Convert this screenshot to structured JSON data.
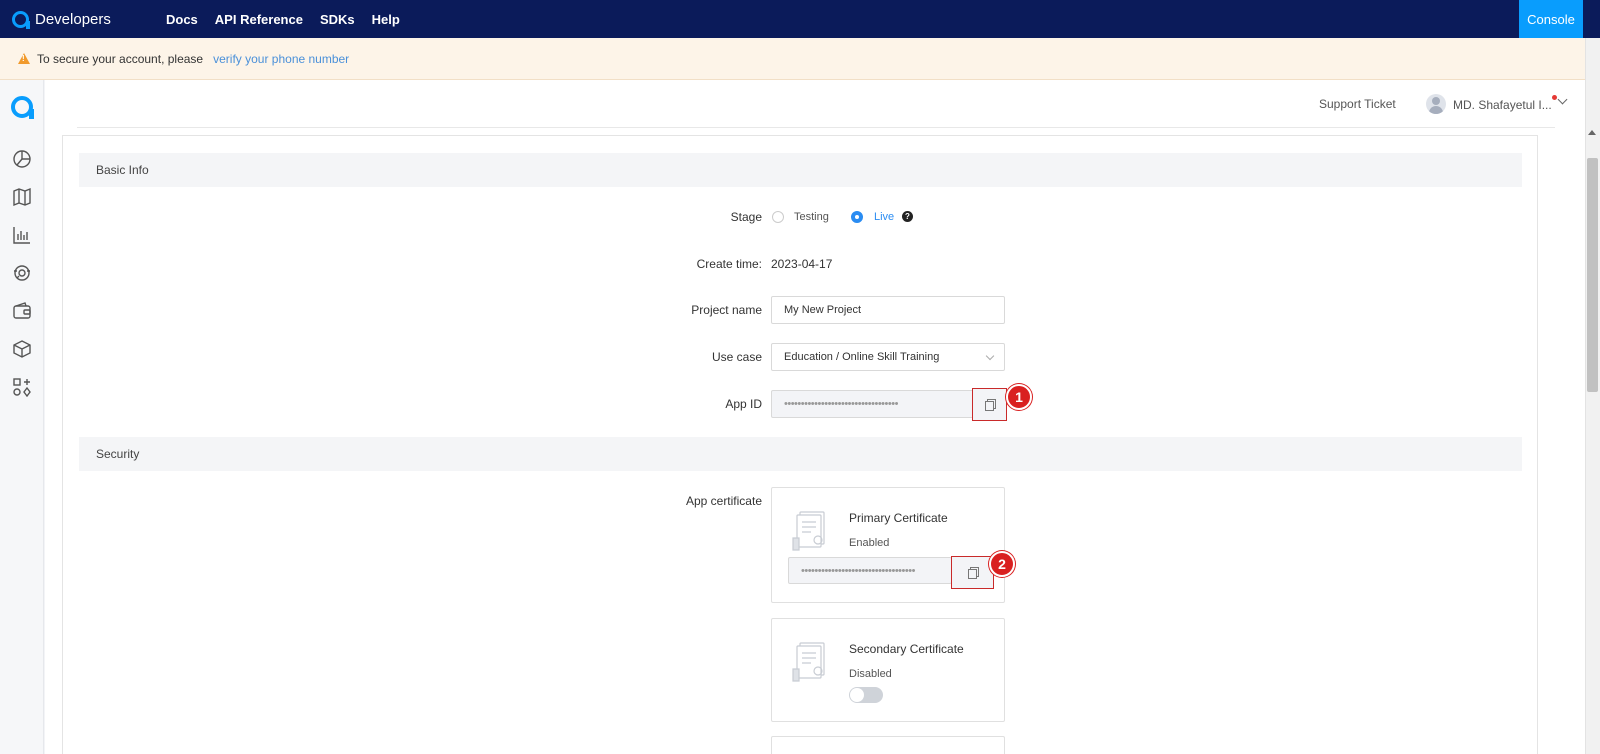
{
  "topnav": {
    "brand": "Developers",
    "links": [
      "Docs",
      "API Reference",
      "SDKs",
      "Help"
    ],
    "console": "Console"
  },
  "banner": {
    "text": "To secure your account, please",
    "link": "verify your phone number"
  },
  "header": {
    "support": "Support Ticket",
    "user_name": "MD. Shafayetul I..."
  },
  "basic_info": {
    "title": "Basic Info",
    "stage_label": "Stage",
    "stage_options": [
      "Testing",
      "Live"
    ],
    "stage_selected": "Live",
    "create_time_label": "Create time:",
    "create_time": "2023-04-17",
    "project_name_label": "Project name",
    "project_name": "My New Project",
    "use_case_label": "Use case",
    "use_case": "Education / Online Skill Training",
    "app_id_label": "App ID",
    "app_id_masked": "••••••••••••••••••••••••••••••••••"
  },
  "security": {
    "title": "Security",
    "app_certificate_label": "App certificate",
    "primary": {
      "title": "Primary Certificate",
      "status": "Enabled",
      "masked": "••••••••••••••••••••••••••••••••••"
    },
    "secondary": {
      "title": "Secondary Certificate",
      "status": "Disabled"
    }
  },
  "annotations": [
    "1",
    "2"
  ],
  "colors": {
    "nav": "#0b1b5a",
    "accent": "#099dfd",
    "highlight": "#d92020"
  }
}
